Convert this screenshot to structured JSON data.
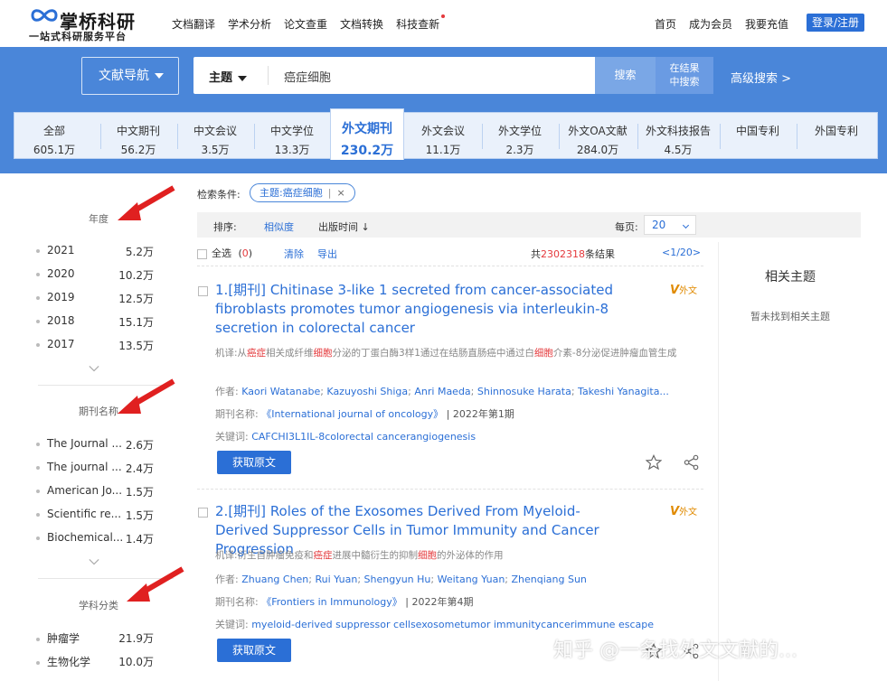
{
  "header": {
    "logo_title": "掌桥科研",
    "logo_subtitle": "一站式科研服务平台",
    "nav": [
      "文档翻译",
      "学术分析",
      "论文查重",
      "文档转换",
      "科技查新"
    ],
    "links": [
      "首页",
      "成为会员",
      "我要充值"
    ],
    "login_label": "登录/注册"
  },
  "search": {
    "nav_label": "文献导航",
    "field": "主题",
    "query": "癌症细胞",
    "search_label": "搜索",
    "in_result_line1": "在结果",
    "in_result_line2": "中搜索",
    "advanced_label": "高级搜索 >"
  },
  "tabs": [
    {
      "label": "全部",
      "count": "605.1万"
    },
    {
      "label": "中文期刊",
      "count": "56.2万"
    },
    {
      "label": "中文会议",
      "count": "3.5万"
    },
    {
      "label": "中文学位",
      "count": "13.3万"
    },
    {
      "label": "外文期刊",
      "count": "230.2万",
      "active": true
    },
    {
      "label": "外文会议",
      "count": "11.1万"
    },
    {
      "label": "外文学位",
      "count": "2.3万"
    },
    {
      "label": "外文OA文献",
      "count": "284.0万"
    },
    {
      "label": "外文科技报告",
      "count": "4.5万"
    },
    {
      "label": "中国专利",
      "count": ""
    },
    {
      "label": "外国专利",
      "count": ""
    }
  ],
  "facets": {
    "year": {
      "title": "年度",
      "items": [
        {
          "name": "2021",
          "count": "5.2万"
        },
        {
          "name": "2020",
          "count": "10.2万"
        },
        {
          "name": "2019",
          "count": "12.5万"
        },
        {
          "name": "2018",
          "count": "15.1万"
        },
        {
          "name": "2017",
          "count": "13.5万"
        }
      ]
    },
    "journal": {
      "title": "期刊名称",
      "items": [
        {
          "name": "The Journal ...",
          "count": "2.6万"
        },
        {
          "name": "The journal ...",
          "count": "2.4万"
        },
        {
          "name": "American Jo...",
          "count": "1.5万"
        },
        {
          "name": "Scientific re...",
          "count": "1.5万"
        },
        {
          "name": "Biochemical...",
          "count": "1.4万"
        }
      ]
    },
    "subject": {
      "title": "学科分类",
      "items": [
        {
          "name": "肿瘤学",
          "count": "21.9万"
        },
        {
          "name": "生物化学",
          "count": "10.0万"
        }
      ]
    }
  },
  "conditions": {
    "label": "检索条件:",
    "tag": "主题:癌症细胞",
    "sep": "|",
    "remove": "×"
  },
  "sort": {
    "label": "排序:",
    "relevance": "相似度",
    "date": "出版时间 ↓",
    "per_page_label": "每页:",
    "per_page": "20"
  },
  "selection": {
    "select_all": "全选",
    "selected_open": "(",
    "selected_count": "0",
    "selected_close": ")",
    "clear": "清除",
    "export": "导出",
    "total_prefix": "共",
    "total": "2302318",
    "total_suffix": "条结果",
    "page": "<1/20>"
  },
  "results": [
    {
      "index": "1.",
      "type": "[期刊]",
      "title": "Chitinase 3-like 1 secreted from cancer-associated fibroblasts promotes tumor angiogenesis via interleukin-8 secretion in colorectal cancer",
      "badge_v": "V",
      "badge_text": "外文",
      "trans_label": "机译:",
      "trans_parts": [
        "从",
        "癌症",
        "相关成纤维",
        "细胞",
        "分泌的丁蛋白酶3样1通过在结肠直肠癌中通过白",
        "细胞",
        "介素-8分泌促进肿瘤血管生成"
      ],
      "authors_label": "作者:",
      "authors": [
        "Kaori Watanabe",
        "Kazuyoshi Shiga",
        "Anri Maeda",
        "Shinnosuke Harata",
        "Takeshi Yanagita..."
      ],
      "journal_label": "期刊名称:",
      "journal": "《International journal of oncology》",
      "issue": "| 2022年第1期",
      "keywords_label": "关键词:",
      "keywords": "CAFCHI3L1IL-8colorectal cancerangiogenesis",
      "button": "获取原文"
    },
    {
      "index": "2.",
      "type": "[期刊]",
      "title": "Roles of the Exosomes Derived From Myeloid-Derived Suppressor Cells in Tumor Immunity and Cancer Progression",
      "badge_v": "V",
      "badge_text": "外文",
      "trans_label": "机译:",
      "trans_parts": [
        "衍生自肿瘤免疫和",
        "癌症",
        "进展中髓衍生的抑制",
        "细胞",
        "的外泌体的作用",
        "",
        ""
      ],
      "authors_label": "作者:",
      "authors": [
        "Zhuang Chen",
        "Rui Yuan",
        "Shengyun Hu",
        "Weitang Yuan",
        "Zhenqiang Sun"
      ],
      "journal_label": "期刊名称:",
      "journal": "《Frontiers in Immunology》",
      "issue": "| 2022年第4期",
      "keywords_label": "关键词:",
      "keywords": "myeloid-derived suppressor cellsexosometumor immunitycancerimmune escape",
      "button": "获取原文"
    }
  ],
  "related": {
    "title": "相关主题",
    "empty": "暂未找到相关主题"
  },
  "watermark": "知乎 @一条找外文文献的...",
  "colors": {
    "brand_blue": "#2b6fd6",
    "band_blue": "#4a86d9",
    "highlight_red": "#e4393c",
    "badge_orange": "#e08a00"
  }
}
